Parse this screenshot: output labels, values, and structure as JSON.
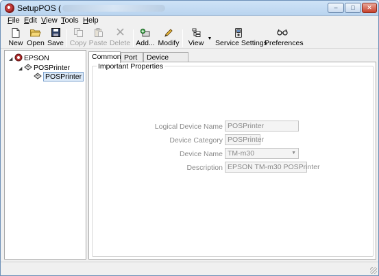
{
  "window": {
    "title": "SetupPOS (",
    "controls": {
      "minimize": "–",
      "maximize": "□",
      "close": "✕"
    }
  },
  "menu": {
    "items": [
      {
        "label": "File",
        "mnemonic": "F",
        "rest": "ile"
      },
      {
        "label": "Edit",
        "mnemonic": "E",
        "rest": "dit"
      },
      {
        "label": "View",
        "mnemonic": "V",
        "rest": "iew"
      },
      {
        "label": "Tools",
        "mnemonic": "T",
        "rest": "ools"
      },
      {
        "label": "Help",
        "mnemonic": "H",
        "rest": "elp"
      }
    ]
  },
  "toolbar": {
    "new": "New",
    "open": "Open",
    "save": "Save",
    "copy": "Copy",
    "paste": "Paste",
    "delete": "Delete",
    "add": "Add...",
    "modify": "Modify",
    "view": "View",
    "service_settings": "Service Settings",
    "preferences": "Preferences"
  },
  "icons": {
    "new": "new-document-icon",
    "open": "open-folder-icon",
    "save": "floppy-disk-icon",
    "copy": "copy-icon",
    "paste": "paste-icon",
    "delete": "delete-x-icon",
    "add": "add-device-icon",
    "modify": "pencil-icon",
    "view": "tree-view-icon",
    "service_settings": "service-settings-icon",
    "preferences": "glasses-icon"
  },
  "tree": {
    "root": "EPSON",
    "category": "POSPrinter",
    "device": "POSPrinter"
  },
  "tabs": {
    "common": "Common",
    "port": "Port",
    "details": "Device Details"
  },
  "properties": {
    "group_title": "Important Properties",
    "logical_name_label": "Logical Device Name",
    "logical_name_value": "POSPrinter",
    "category_label": "Device Category",
    "category_value": "POSPrinter",
    "device_name_label": "Device Name",
    "device_name_value": "TM-m30",
    "description_label": "Description",
    "description_value": "EPSON TM-m30 POSPrinter"
  },
  "colors": {
    "titlebar": "#b9d4ef",
    "selection": "#dbe9f8",
    "disabled_text": "#8a8a8a"
  }
}
